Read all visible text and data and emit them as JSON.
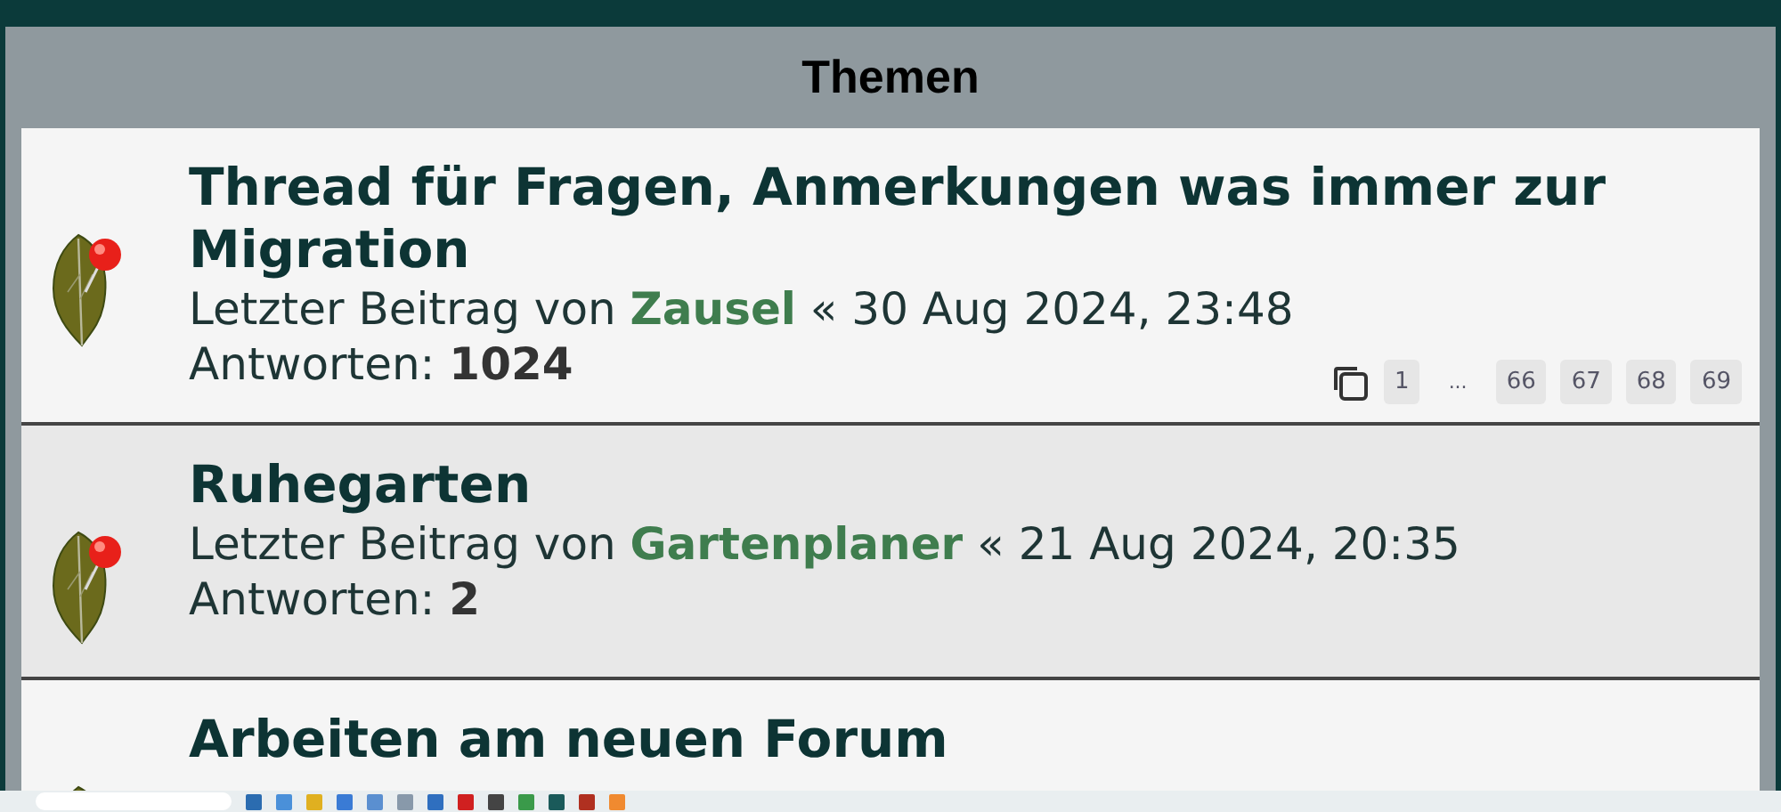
{
  "header": {
    "title": "Themen"
  },
  "topics": [
    {
      "title": "Thread für Fragen, Anmerkungen was immer zur Migration",
      "meta_prefix": "Letzter Beitrag von",
      "author": "Zausel",
      "meta_suffix": "« 30 Aug 2024, 23:48",
      "replies_label": "Antworten:",
      "replies": "1024",
      "pages": [
        {
          "kind": "page",
          "label": "1"
        },
        {
          "kind": "ellipsis",
          "label": "..."
        },
        {
          "kind": "page",
          "label": "66"
        },
        {
          "kind": "page",
          "label": "67"
        },
        {
          "kind": "page",
          "label": "68"
        },
        {
          "kind": "page",
          "label": "69"
        }
      ]
    },
    {
      "title": "Ruhegarten",
      "meta_prefix": "Letzter Beitrag von",
      "author": "Gartenplaner",
      "meta_suffix": "« 21 Aug 2024, 20:35",
      "replies_label": "Antworten:",
      "replies": "2"
    },
    {
      "title": "Arbeiten am neuen Forum"
    }
  ]
}
